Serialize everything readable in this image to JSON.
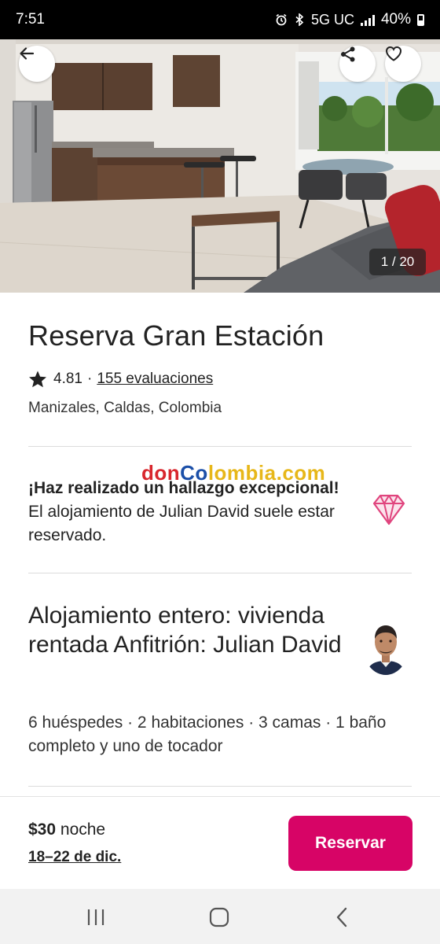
{
  "status_bar": {
    "time": "7:51",
    "network": "5G UC",
    "battery": "40%",
    "icons": [
      "alarm-icon",
      "bluetooth-icon",
      "signal-icon",
      "battery-icon"
    ]
  },
  "gallery": {
    "counter": "1 / 20",
    "actions": [
      "back-arrow-icon",
      "share-icon",
      "heart-icon"
    ]
  },
  "listing": {
    "title": "Reserva Gran Estación",
    "rating": "4.81",
    "separator": "·",
    "reviews": "155 evaluaciones",
    "location": "Manizales, Caldas, Colombia"
  },
  "watermark": {
    "part1": "don",
    "part2": "Co",
    "part3": "lombia.com"
  },
  "rare_find": {
    "bold": "¡Haz realizado un hallazgo excepcional!",
    "text": "El alojamiento de Julian David suele estar reservado.",
    "icon": "diamond-icon"
  },
  "host": {
    "title": "Alojamiento entero: vivienda rentada Anfitrión: Julian David"
  },
  "details": {
    "text": "6 huéspedes · 2 habitaciones · 3 camas · 1 baño completo y uno de tocador"
  },
  "footer": {
    "price": "$30",
    "unit": "noche",
    "dates": "18–22 de dic.",
    "reserve_label": "Reservar"
  },
  "nav": [
    "recents-icon",
    "home-icon",
    "back-icon"
  ],
  "colors": {
    "brand": "#d70466",
    "diamond": "#e0457e"
  }
}
